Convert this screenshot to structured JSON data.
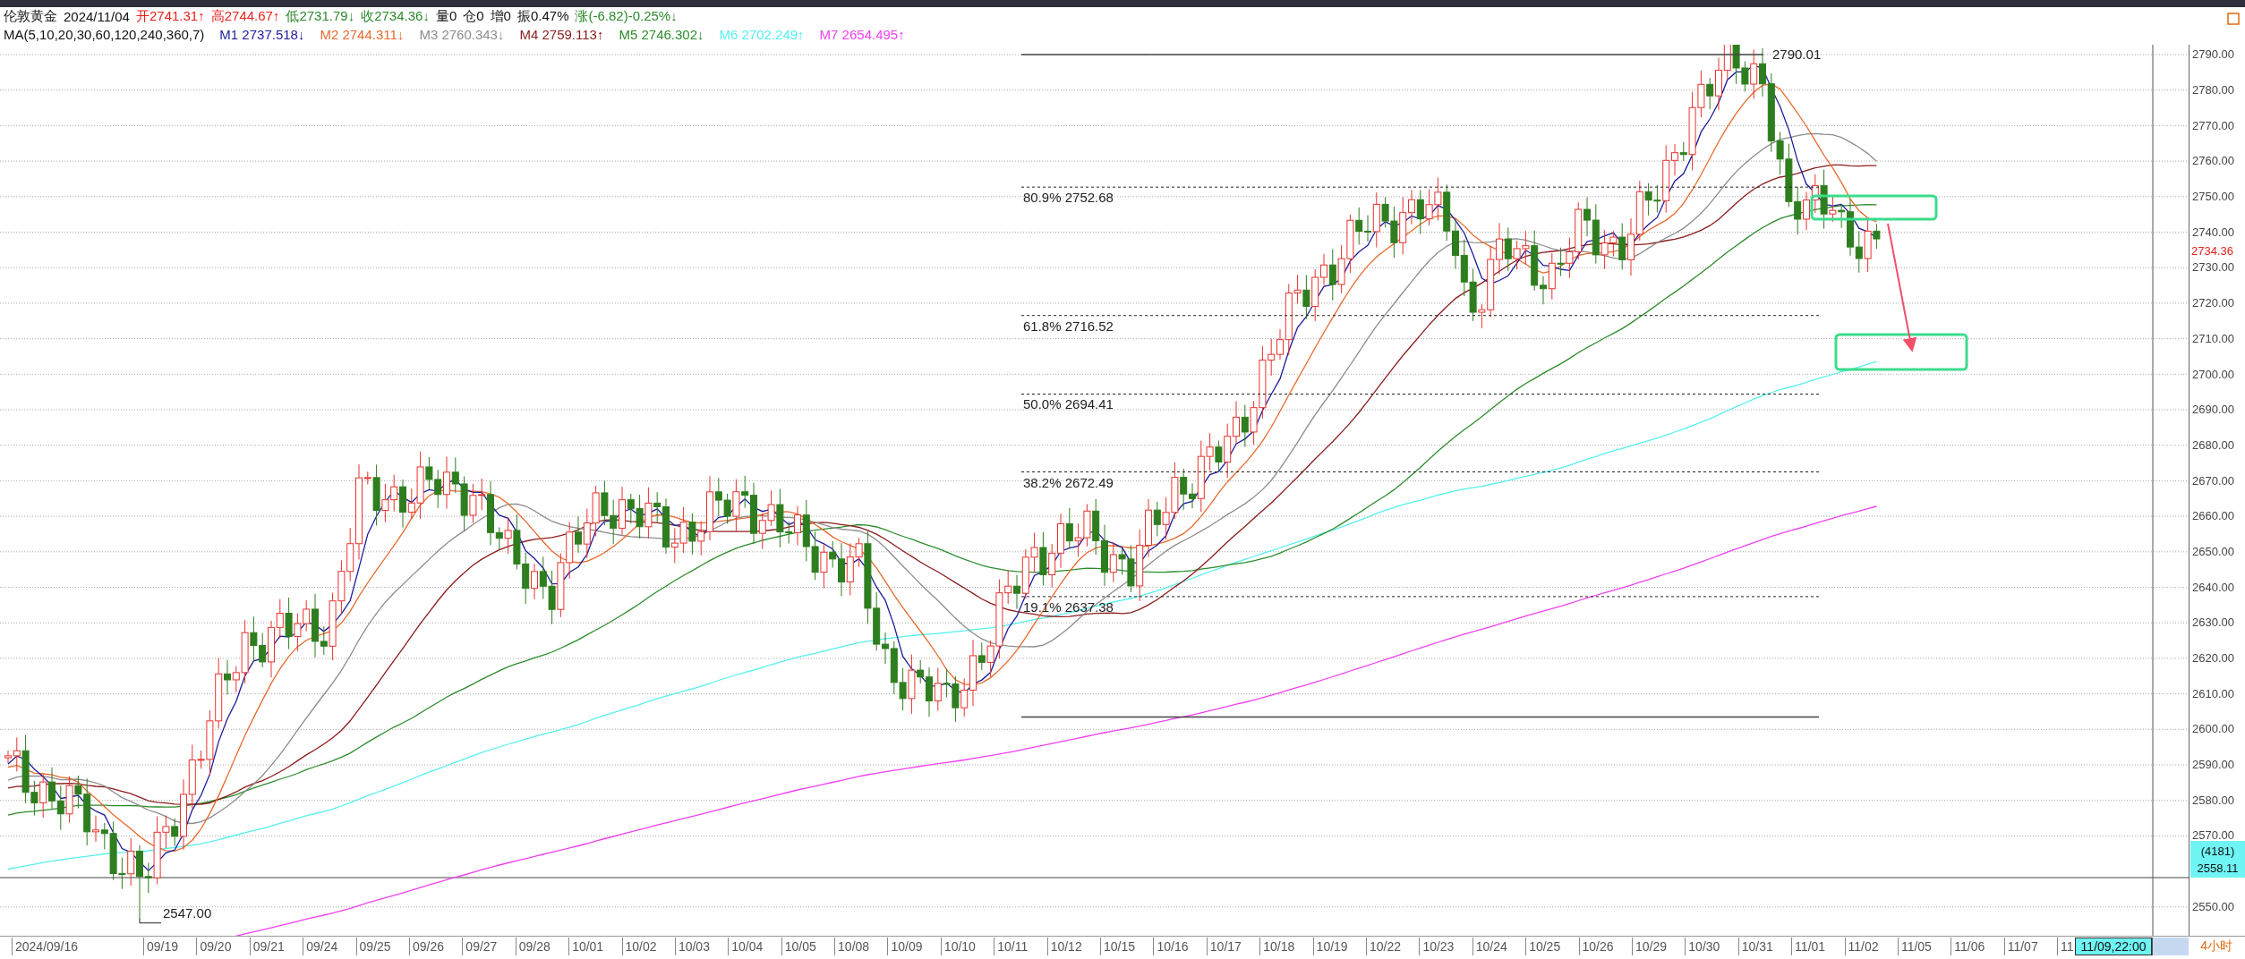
{
  "header": {
    "instrument": "伦敦黄金",
    "date": "2024/11/04",
    "quote": [
      {
        "text": "开2741.31↑",
        "kind": "up"
      },
      {
        "text": "高2744.67↑",
        "kind": "up"
      },
      {
        "text": "低2731.79↓",
        "kind": "down"
      },
      {
        "text": "收2734.36↓",
        "kind": "down"
      },
      {
        "text": "量0",
        "kind": "plain"
      },
      {
        "text": "仓0",
        "kind": "plain"
      },
      {
        "text": "增0",
        "kind": "plain"
      },
      {
        "text": "振0.47%",
        "kind": "plain"
      },
      {
        "text": "涨(-6.82)-0.25%↓",
        "kind": "down"
      }
    ]
  },
  "ma_line": {
    "params": "MA(5,10,20,30,60,120,240,360,7)",
    "items": [
      {
        "label": "M1",
        "value": "2737.518↓",
        "color": "#1c1c9c"
      },
      {
        "label": "M2",
        "value": "2744.311↓",
        "color": "#e86a2c"
      },
      {
        "label": "M3",
        "value": "2760.343↓",
        "color": "#8c8c8c"
      },
      {
        "label": "M4",
        "value": "2759.113↑",
        "color": "#8b1c1c"
      },
      {
        "label": "M5",
        "value": "2746.302↓",
        "color": "#2c8c2c"
      },
      {
        "label": "M6",
        "value": "2702.249↑",
        "color": "#55f0f0"
      },
      {
        "label": "M7",
        "value": "2654.495↑",
        "color": "#f040f0"
      }
    ]
  },
  "chart": {
    "fib_levels": [
      {
        "label": "80.9% 2752.68"
      },
      {
        "label": "61.8% 2716.52"
      },
      {
        "label": "50.0% 2694.41"
      },
      {
        "label": "38.2% 2672.49"
      },
      {
        "label": "19.1% 2637.38"
      }
    ],
    "high_label": "2790.01",
    "low_label": "2547.00",
    "price_axis": [
      "2790.00",
      "2780.00",
      "2770.00",
      "2760.00",
      "2750.00",
      "2740.00",
      "2730.00",
      "2720.00",
      "2710.00",
      "2700.00",
      "2690.00",
      "2680.00",
      "2670.00",
      "2660.00",
      "2650.00",
      "2640.00",
      "2630.00",
      "2620.00",
      "2610.00",
      "2600.00",
      "2590.00",
      "2580.00",
      "2570.00"
    ],
    "lower_axis": "2550.00",
    "last_price": "2734.36",
    "cursor_box": {
      "count": "(4181)",
      "price": "2558.11"
    }
  },
  "time_axis": {
    "dates": [
      "2024/09/16",
      "09/19",
      "09/20",
      "09/21",
      "09/24",
      "09/25",
      "09/26",
      "09/27",
      "09/28",
      "10/01",
      "10/02",
      "10/03",
      "10/04",
      "10/05",
      "10/08",
      "10/09",
      "10/10",
      "10/11",
      "10/12",
      "10/15",
      "10/16",
      "10/17",
      "10/18",
      "10/19",
      "10/22",
      "10/23",
      "10/24",
      "10/25",
      "10/26",
      "10/29",
      "10/30",
      "10/31",
      "11/01",
      "11/02",
      "11/05",
      "11/06",
      "11/07",
      "11"
    ],
    "cursor_time": "11/09,22:00",
    "period": "4小时"
  }
}
